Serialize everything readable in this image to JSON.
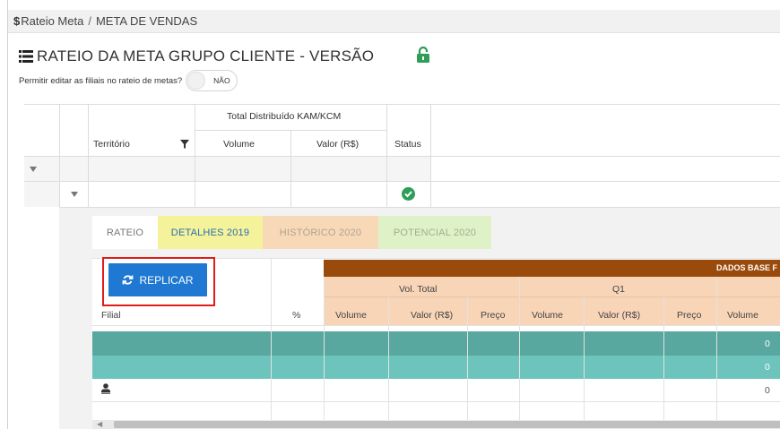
{
  "breadcrumb": {
    "dollar": "$",
    "root": "Rateio Meta",
    "separator": "/",
    "current": "META DE VENDAS"
  },
  "header": {
    "title": "RATEIO DA META GRUPO CLIENTE - VERSÃO",
    "lock_state": "unlocked",
    "lock_color": "#2e9e59",
    "permit_label": "Permitir editar as filiais no rateio de metas?",
    "permit_toggle_text": "NÃO"
  },
  "grid": {
    "group_header": "Total Distribuído KAM/KCM",
    "columns": [
      "Território",
      "Volume",
      "Valor (R$)",
      "Status"
    ],
    "rows": [
      {
        "expand": "collapse",
        "status": ""
      },
      {
        "expand": "collapse",
        "status": "ok"
      }
    ],
    "status_ok_color": "#2e9e59"
  },
  "detail": {
    "tabs": [
      {
        "label": "RATEIO",
        "active": false
      },
      {
        "label": "DETALHES 2019",
        "active": true
      },
      {
        "label": "HISTÓRICO 2020",
        "active": false
      },
      {
        "label": "POTENCIAL 2020",
        "active": false
      }
    ],
    "replicar_label": "REPLICAR",
    "banner": "DADOS BASE F",
    "subgroups": [
      "Vol. Total",
      "Q1"
    ],
    "columns": [
      "Filial",
      "%",
      "Volume",
      "Valor (R$)",
      "Preço",
      "Volume",
      "Valor (R$)",
      "Preço",
      "Volume"
    ],
    "rows": [
      {
        "style": "teal-dark",
        "last_value": "0"
      },
      {
        "style": "teal-light",
        "last_value": "0"
      },
      {
        "style": "white",
        "last_value": "0",
        "icon": "user-icon"
      }
    ],
    "colors": {
      "banner": "#9a4a0b",
      "peach": "#f9d5b8",
      "teal_dark": "#58a8a0",
      "teal_light": "#6cc4bd",
      "button": "#1f78d1",
      "highlight_outline": "#e11a1a"
    }
  }
}
